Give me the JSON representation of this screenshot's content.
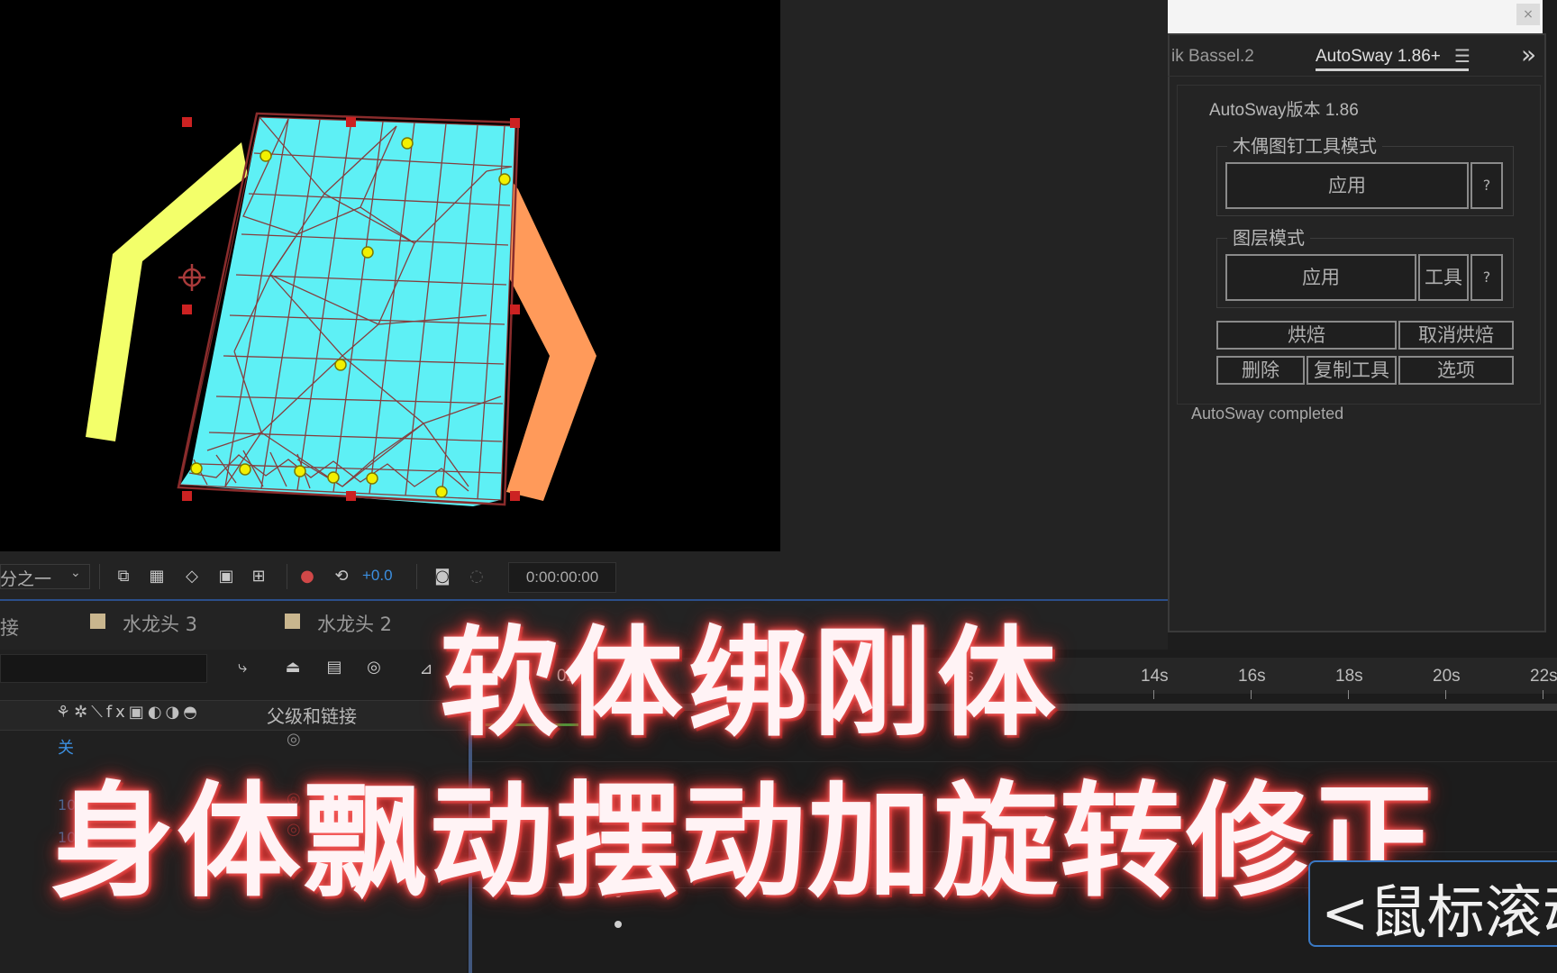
{
  "panel": {
    "tab_prev": "ik Bassel.2",
    "tab_active": "AutoSway 1.86+",
    "menu_icon": "☰",
    "expand_icon": "»",
    "close_icon": "×",
    "version_title": "AutoSway版本 1.86",
    "puppet_group": "木偶图钉工具模式",
    "puppet_apply": "应用",
    "puppet_help": "?",
    "layer_group": "图层模式",
    "layer_apply": "应用",
    "layer_tool": "工具",
    "layer_help": "?",
    "bake": "烘焙",
    "unbake": "取消烘焙",
    "delete": "删除",
    "copy_tool": "复制工具",
    "options": "选项",
    "status": "AutoSway completed"
  },
  "toolbar": {
    "resolution": "分之一",
    "exposure": "+0.0",
    "timecode": "0:00:00:00"
  },
  "timeline": {
    "tab_link": "接",
    "tab_1": "水龙头 3",
    "tab_2": "水龙头 2",
    "parent_header": "父级和链接",
    "switch_off": "关",
    "ruler_labels": [
      "02s",
      "10s",
      "14s",
      "16s",
      "18s",
      "20s",
      "22s"
    ],
    "row_values": [
      "10",
      "10.0"
    ]
  },
  "captions": {
    "line1": "软体绑刚体",
    "line2": "身体飘动摆动加旋转修正",
    "tooltip": "<鼠标滚动"
  },
  "colors": {
    "mesh_fill": "#5ef0f5",
    "left_arm": "#f3ff6a",
    "right_arm": "#ff9a5a",
    "mesh_line": "#8a2c2c",
    "pin": "#f2f000"
  }
}
